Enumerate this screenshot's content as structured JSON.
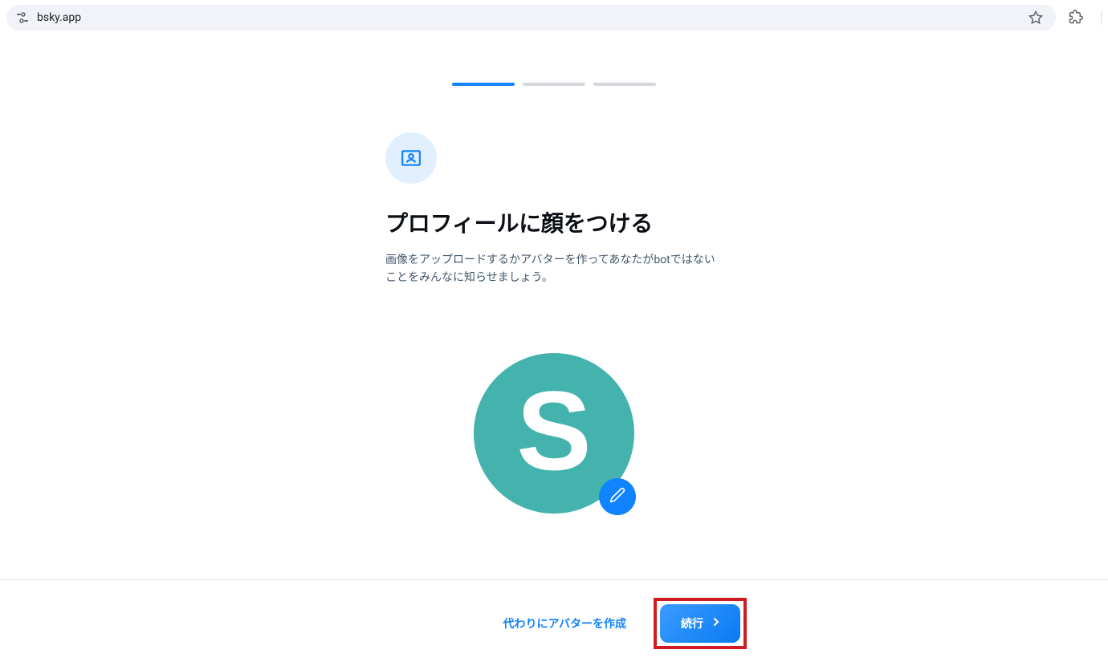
{
  "browser": {
    "url": "bsky.app"
  },
  "progress": {
    "total_steps": 3,
    "active_step": 1
  },
  "onboarding": {
    "heading": "プロフィールに顔をつける",
    "subtitle": "画像をアップロードするかアバターを作ってあなたがbotではないことをみんなに知らせましょう。",
    "avatar_letter": "S"
  },
  "footer": {
    "secondary_action": "代わりにアバターを作成",
    "primary_action": "続行"
  },
  "colors": {
    "accent": "#1083fe",
    "avatar_bg": "#44b3ad",
    "highlight_border": "#cf1c22"
  }
}
